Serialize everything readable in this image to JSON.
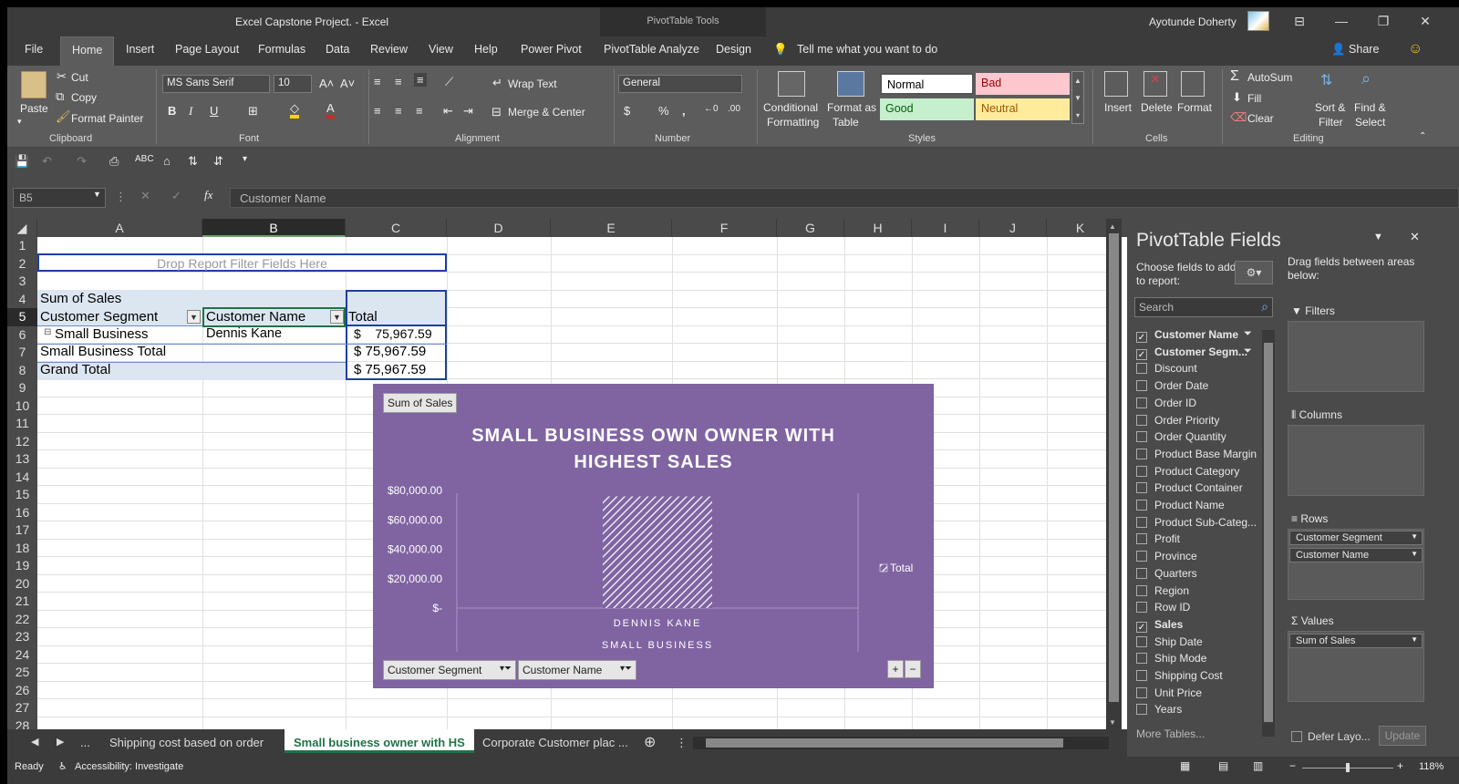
{
  "window": {
    "title": "Excel Capstone Project.  -  Excel",
    "context_tools": "PivotTable Tools",
    "user": "Ayotunde Doherty"
  },
  "ribbon_tabs": [
    "File",
    "Home",
    "Insert",
    "Page Layout",
    "Formulas",
    "Data",
    "Review",
    "View",
    "Help",
    "Power Pivot",
    "PivotTable Analyze",
    "Design"
  ],
  "tell_me": "Tell me what you want to do",
  "share": "Share",
  "ribbon": {
    "clipboard": {
      "paste": "Paste",
      "cut": "Cut",
      "copy": "Copy",
      "format_painter": "Format Painter",
      "label": "Clipboard"
    },
    "font": {
      "name": "MS Sans Serif",
      "size": "10",
      "label": "Font"
    },
    "alignment": {
      "wrap": "Wrap Text",
      "merge": "Merge & Center",
      "label": "Alignment"
    },
    "number": {
      "format": "General",
      "label": "Number"
    },
    "styles": {
      "conditional": "Conditional",
      "conditional2": "Formatting",
      "format_table": "Format as",
      "format_table2": "Table",
      "normal": "Normal",
      "bad": "Bad",
      "good": "Good",
      "neutral": "Neutral",
      "label": "Styles"
    },
    "cells": {
      "insert": "Insert",
      "delete": "Delete",
      "format": "Format",
      "label": "Cells"
    },
    "editing": {
      "autosum": "AutoSum",
      "fill": "Fill",
      "clear": "Clear",
      "sort": "Sort &",
      "sort2": "Filter",
      "find": "Find &",
      "find2": "Select",
      "label": "Editing"
    }
  },
  "formula_bar": {
    "name_box": "B5",
    "formula": "Customer Name"
  },
  "columns": [
    "A",
    "B",
    "C",
    "D",
    "E",
    "F",
    "G",
    "H",
    "I",
    "J",
    "K"
  ],
  "rows": [
    "1",
    "2",
    "3",
    "4",
    "5",
    "6",
    "7",
    "8",
    "9",
    "10",
    "11",
    "12",
    "13",
    "14",
    "15",
    "16",
    "17",
    "18",
    "19",
    "20",
    "21",
    "22",
    "23",
    "24",
    "25",
    "26",
    "27",
    "28"
  ],
  "pivot": {
    "filter_drop": "Drop Report Filter Fields Here",
    "sum_label": "Sum of Sales",
    "hdr_segment": "Customer Segment",
    "hdr_name": "Customer Name",
    "hdr_total": "Total",
    "row_segment": "Small Business",
    "row_name": "Dennis Kane",
    "row_value": "$    75,967.59",
    "subtotal_label": "Small Business Total",
    "subtotal_value": "$ 75,967.59",
    "grand_label": "Grand Total",
    "grand_value": "$ 75,967.59"
  },
  "chart_data": {
    "type": "bar",
    "title": "SMALL BUSINESS OWN OWNER WITH HIGHEST SALES",
    "title_line1": "SMALL BUSINESS OWN OWNER WITH",
    "title_line2": "HIGHEST SALES",
    "value_button": "Sum of Sales",
    "categories": [
      "DENNIS KANE"
    ],
    "outer_category": "SMALL BUSINESS",
    "series": [
      {
        "name": "Total",
        "values": [
          75967.59
        ]
      }
    ],
    "y_ticks": [
      "$80,000.00",
      "$60,000.00",
      "$40,000.00",
      "$20,000.00",
      "$-"
    ],
    "ylim": [
      0,
      80000
    ],
    "legend": "right",
    "field_buttons": [
      "Customer Segment",
      "Customer Name"
    ],
    "bar_color": "#ffffff"
  },
  "sheet_tabs": [
    "...",
    "Shipping cost based on order",
    "Small business owner with HS",
    "Corporate Customer plac ..."
  ],
  "status": {
    "ready": "Ready",
    "accessibility": "Accessibility: Investigate",
    "zoom": "118%"
  },
  "pane": {
    "title": "PivotTable Fields",
    "choose": "Choose fields to add to report:",
    "drag": "Drag fields between areas below:",
    "search_placeholder": "Search",
    "fields": [
      {
        "name": "Customer Name",
        "checked": true
      },
      {
        "name": "Customer Segm...",
        "checked": true
      },
      {
        "name": "Discount",
        "checked": false
      },
      {
        "name": "Order Date",
        "checked": false
      },
      {
        "name": "Order ID",
        "checked": false
      },
      {
        "name": "Order Priority",
        "checked": false
      },
      {
        "name": "Order Quantity",
        "checked": false
      },
      {
        "name": "Product Base Margin",
        "checked": false
      },
      {
        "name": "Product Category",
        "checked": false
      },
      {
        "name": "Product Container",
        "checked": false
      },
      {
        "name": "Product Name",
        "checked": false
      },
      {
        "name": "Product Sub-Categ...",
        "checked": false
      },
      {
        "name": "Profit",
        "checked": false
      },
      {
        "name": "Province",
        "checked": false
      },
      {
        "name": "Quarters",
        "checked": false
      },
      {
        "name": "Region",
        "checked": false
      },
      {
        "name": "Row ID",
        "checked": false
      },
      {
        "name": "Sales",
        "checked": true
      },
      {
        "name": "Ship Date",
        "checked": false
      },
      {
        "name": "Ship Mode",
        "checked": false
      },
      {
        "name": "Shipping Cost",
        "checked": false
      },
      {
        "name": "Unit Price",
        "checked": false
      },
      {
        "name": "Years",
        "checked": false
      }
    ],
    "more_tables": "More Tables...",
    "filters": "Filters",
    "columns": "Columns",
    "rows": "Rows",
    "values": "Values",
    "rows_items": [
      "Customer Segment",
      "Customer Name"
    ],
    "values_items": [
      "Sum of Sales"
    ],
    "defer": "Defer Layo...",
    "update": "Update"
  }
}
